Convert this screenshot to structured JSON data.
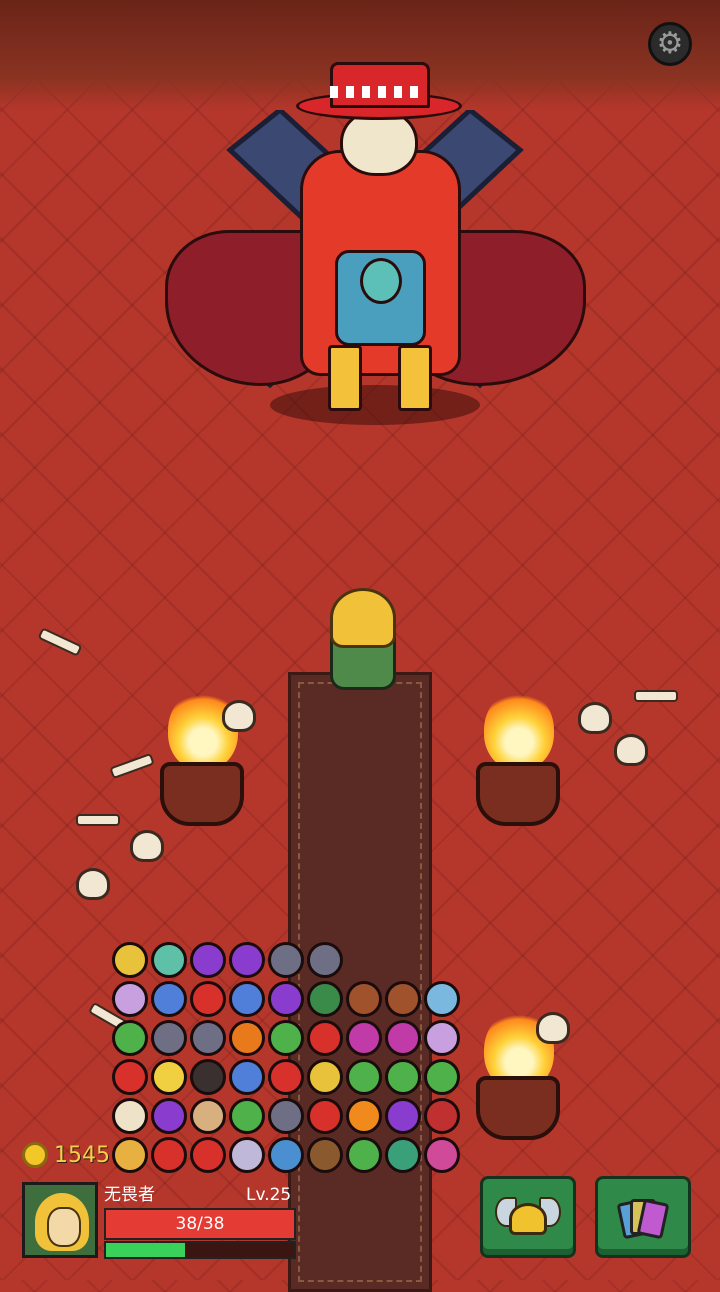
{
  "player": {
    "name": "无畏者",
    "level_text": "Lv.25",
    "hp_text": "38/38",
    "hp_fraction": 1.0,
    "xp_fraction": 0.42
  },
  "currency": {
    "gold": "1545"
  },
  "colors": {
    "floor": "#b5362b",
    "hp": "#e43b34",
    "xp": "#3ad15a",
    "gold_text": "#f1d04a",
    "button_green": "#2f8a4a"
  },
  "icons": {
    "settings": "gear-icon",
    "equipment_button": "winged-helmet-icon",
    "cards_button": "card-deck-icon",
    "currency": "gold-coin-icon"
  },
  "inventory_rows": [
    [
      "gold-coin",
      "potion-flask",
      "purple-mark",
      "purple-mark",
      "gray-gem",
      "gray-gem"
    ],
    [
      "clock-charm",
      "blue-flame",
      "red-rune",
      "blue-flame",
      "purple-shield",
      "striped-orb",
      "copper-orb",
      "copper-orb",
      "crystal-vial"
    ],
    [
      "green-star",
      "gray-hex",
      "gray-hex",
      "orange-gem",
      "green-splash",
      "red-heart",
      "magenta-ring",
      "magenta-ring",
      "clock-charm"
    ],
    [
      "red-dagger",
      "yellow-star",
      "dark-pot",
      "blue-fist",
      "red-demon",
      "gold-scroll",
      "green-feather",
      "green-head",
      "green-star"
    ],
    [
      "bone",
      "purple-beast",
      "sack",
      "green-bow",
      "gray-hex",
      "red-triangle",
      "fire-star",
      "purple-crown",
      "fang-ring"
    ],
    [
      "horn",
      "red-heart-locket",
      "red-hourglass",
      "skull-bat",
      "blue-mushroom",
      "brown-pouch",
      "green-jar",
      "jade-ring",
      "pink-demon"
    ]
  ]
}
